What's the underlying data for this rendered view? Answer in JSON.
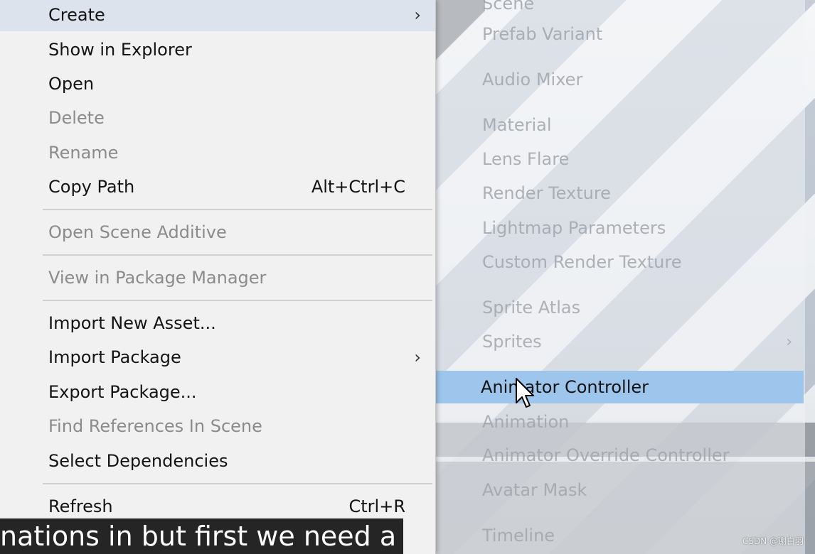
{
  "context_menu": {
    "items": [
      {
        "label": "Create",
        "state": "hover",
        "submenu": true
      },
      {
        "label": "Show in Explorer",
        "state": "enabled"
      },
      {
        "label": "Open",
        "state": "enabled"
      },
      {
        "label": "Delete",
        "state": "disabled"
      },
      {
        "label": "Rename",
        "state": "disabled"
      },
      {
        "label": "Copy Path",
        "shortcut": "Alt+Ctrl+C",
        "state": "enabled"
      },
      {
        "label": "Open Scene Additive",
        "state": "disabled"
      },
      {
        "label": "View in Package Manager",
        "state": "disabled"
      },
      {
        "label": "Import New Asset...",
        "state": "enabled"
      },
      {
        "label": "Import Package",
        "state": "enabled",
        "submenu": true
      },
      {
        "label": "Export Package...",
        "state": "enabled"
      },
      {
        "label": "Find References In Scene",
        "state": "disabled"
      },
      {
        "label": "Select Dependencies",
        "state": "enabled"
      },
      {
        "label": "Refresh",
        "shortcut": "Ctrl+R",
        "state": "enabled"
      }
    ],
    "submenu_arrow": "›"
  },
  "create_submenu": {
    "items": [
      {
        "label": "Scene"
      },
      {
        "label": "Prefab Variant"
      },
      {
        "label": "Audio Mixer"
      },
      {
        "label": "Material"
      },
      {
        "label": "Lens Flare"
      },
      {
        "label": "Render Texture"
      },
      {
        "label": "Lightmap Parameters"
      },
      {
        "label": "Custom Render Texture"
      },
      {
        "label": "Sprite Atlas"
      },
      {
        "label": "Sprites",
        "submenu": true
      },
      {
        "label": "Animator Controller",
        "selected": true
      },
      {
        "label": "Animation"
      },
      {
        "label": "Animator Override Controller"
      },
      {
        "label": "Avatar Mask"
      },
      {
        "label": "Timeline"
      }
    ]
  },
  "caption": {
    "text": "nations in but first we need a"
  },
  "watermark": {
    "text": "CSDN @谢白羽"
  },
  "colors": {
    "selection": "#9ec5ec",
    "menu_bg": "#f1f1f1",
    "hover": "#dde3ec"
  }
}
